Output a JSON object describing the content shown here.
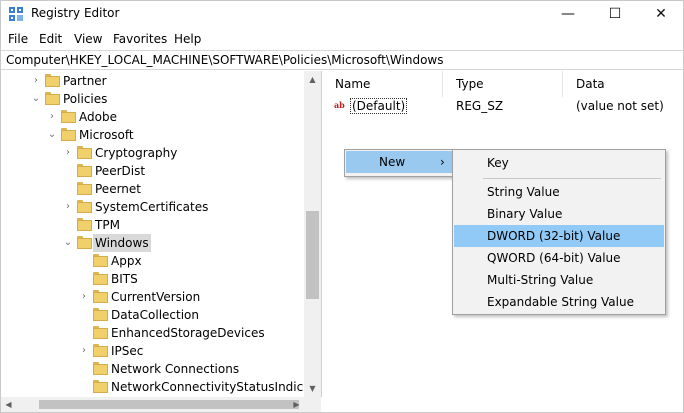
{
  "window": {
    "title": "Registry Editor",
    "minimize": "—",
    "maximize": "☐",
    "close": "✕"
  },
  "menubar": [
    "File",
    "Edit",
    "View",
    "Favorites",
    "Help"
  ],
  "address": "Computer\\HKEY_LOCAL_MACHINE\\SOFTWARE\\Policies\\Microsoft\\Windows",
  "tree": [
    {
      "label": "Partner",
      "expander": "›"
    },
    {
      "label": "Policies",
      "expander": "⌄"
    },
    {
      "label": "Adobe",
      "expander": "›"
    },
    {
      "label": "Microsoft",
      "expander": "⌄"
    },
    {
      "label": "Cryptography",
      "expander": "›"
    },
    {
      "label": "PeerDist",
      "expander": ""
    },
    {
      "label": "Peernet",
      "expander": ""
    },
    {
      "label": "SystemCertificates",
      "expander": "›"
    },
    {
      "label": "TPM",
      "expander": ""
    },
    {
      "label": "Windows",
      "expander": "⌄",
      "selected": true
    },
    {
      "label": "Appx",
      "expander": ""
    },
    {
      "label": "BITS",
      "expander": ""
    },
    {
      "label": "CurrentVersion",
      "expander": "›"
    },
    {
      "label": "DataCollection",
      "expander": ""
    },
    {
      "label": "EnhancedStorageDevices",
      "expander": ""
    },
    {
      "label": "IPSec",
      "expander": "›"
    },
    {
      "label": "Network Connections",
      "expander": ""
    },
    {
      "label": "NetworkConnectivityStatusIndicator",
      "expander": ""
    }
  ],
  "list": {
    "columns": [
      "Name",
      "Type",
      "Data"
    ],
    "rows": [
      {
        "icon": "ab",
        "name": "(Default)",
        "type": "REG_SZ",
        "data": "(value not set)"
      }
    ]
  },
  "context_menu": {
    "new_label": "New",
    "arrow": "›"
  },
  "submenu": {
    "key": "Key",
    "items": [
      "String Value",
      "Binary Value",
      "DWORD (32-bit) Value",
      "QWORD (64-bit) Value",
      "Multi-String Value",
      "Expandable String Value"
    ],
    "highlighted": "DWORD (32-bit) Value"
  },
  "colors": {
    "menu_highlight": "#99c9ef",
    "submenu_highlight": "#91c9f7",
    "folder": "#f1cf6b",
    "tree_selection": "#d9d9d9"
  }
}
